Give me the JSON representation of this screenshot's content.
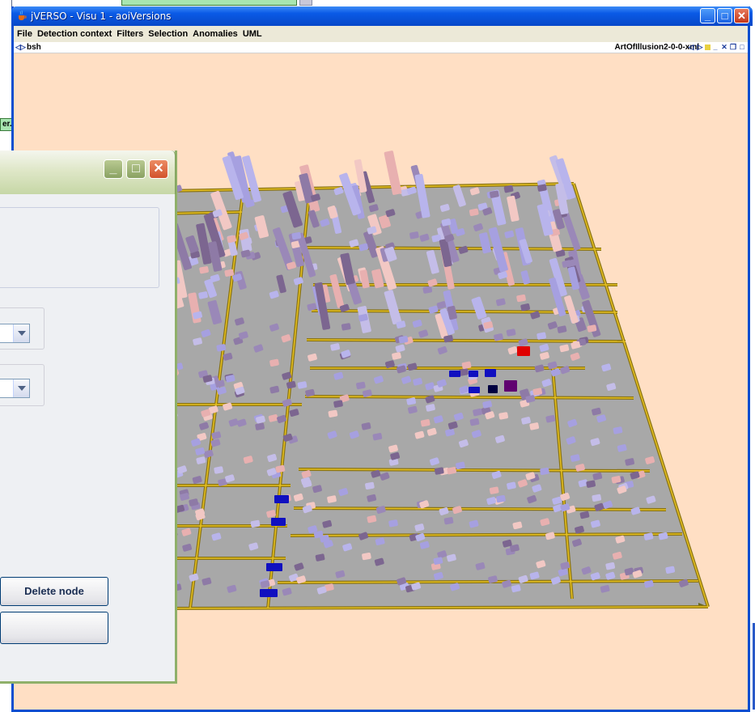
{
  "background": {
    "green_label": "er.."
  },
  "main_window": {
    "title": "jVERSO - Visu 1 - aoiVersions",
    "menu": [
      "File",
      "Detection context",
      "Filters",
      "Selection",
      "Anomalies",
      "UML"
    ],
    "view_tab": "bsh",
    "version_label": "ArtOfIllusion2-0-0-xml"
  },
  "dialog": {
    "delete_node_label": "Delete node",
    "second_button_label": ""
  },
  "colors": {
    "scene_background": "#ffdfc4",
    "floor": "#a8a8a8",
    "package_border": "#7a6a10",
    "title_bar": "#0a5ae6",
    "selected_red": "#e00000",
    "selected_blue": "#1010c0"
  }
}
